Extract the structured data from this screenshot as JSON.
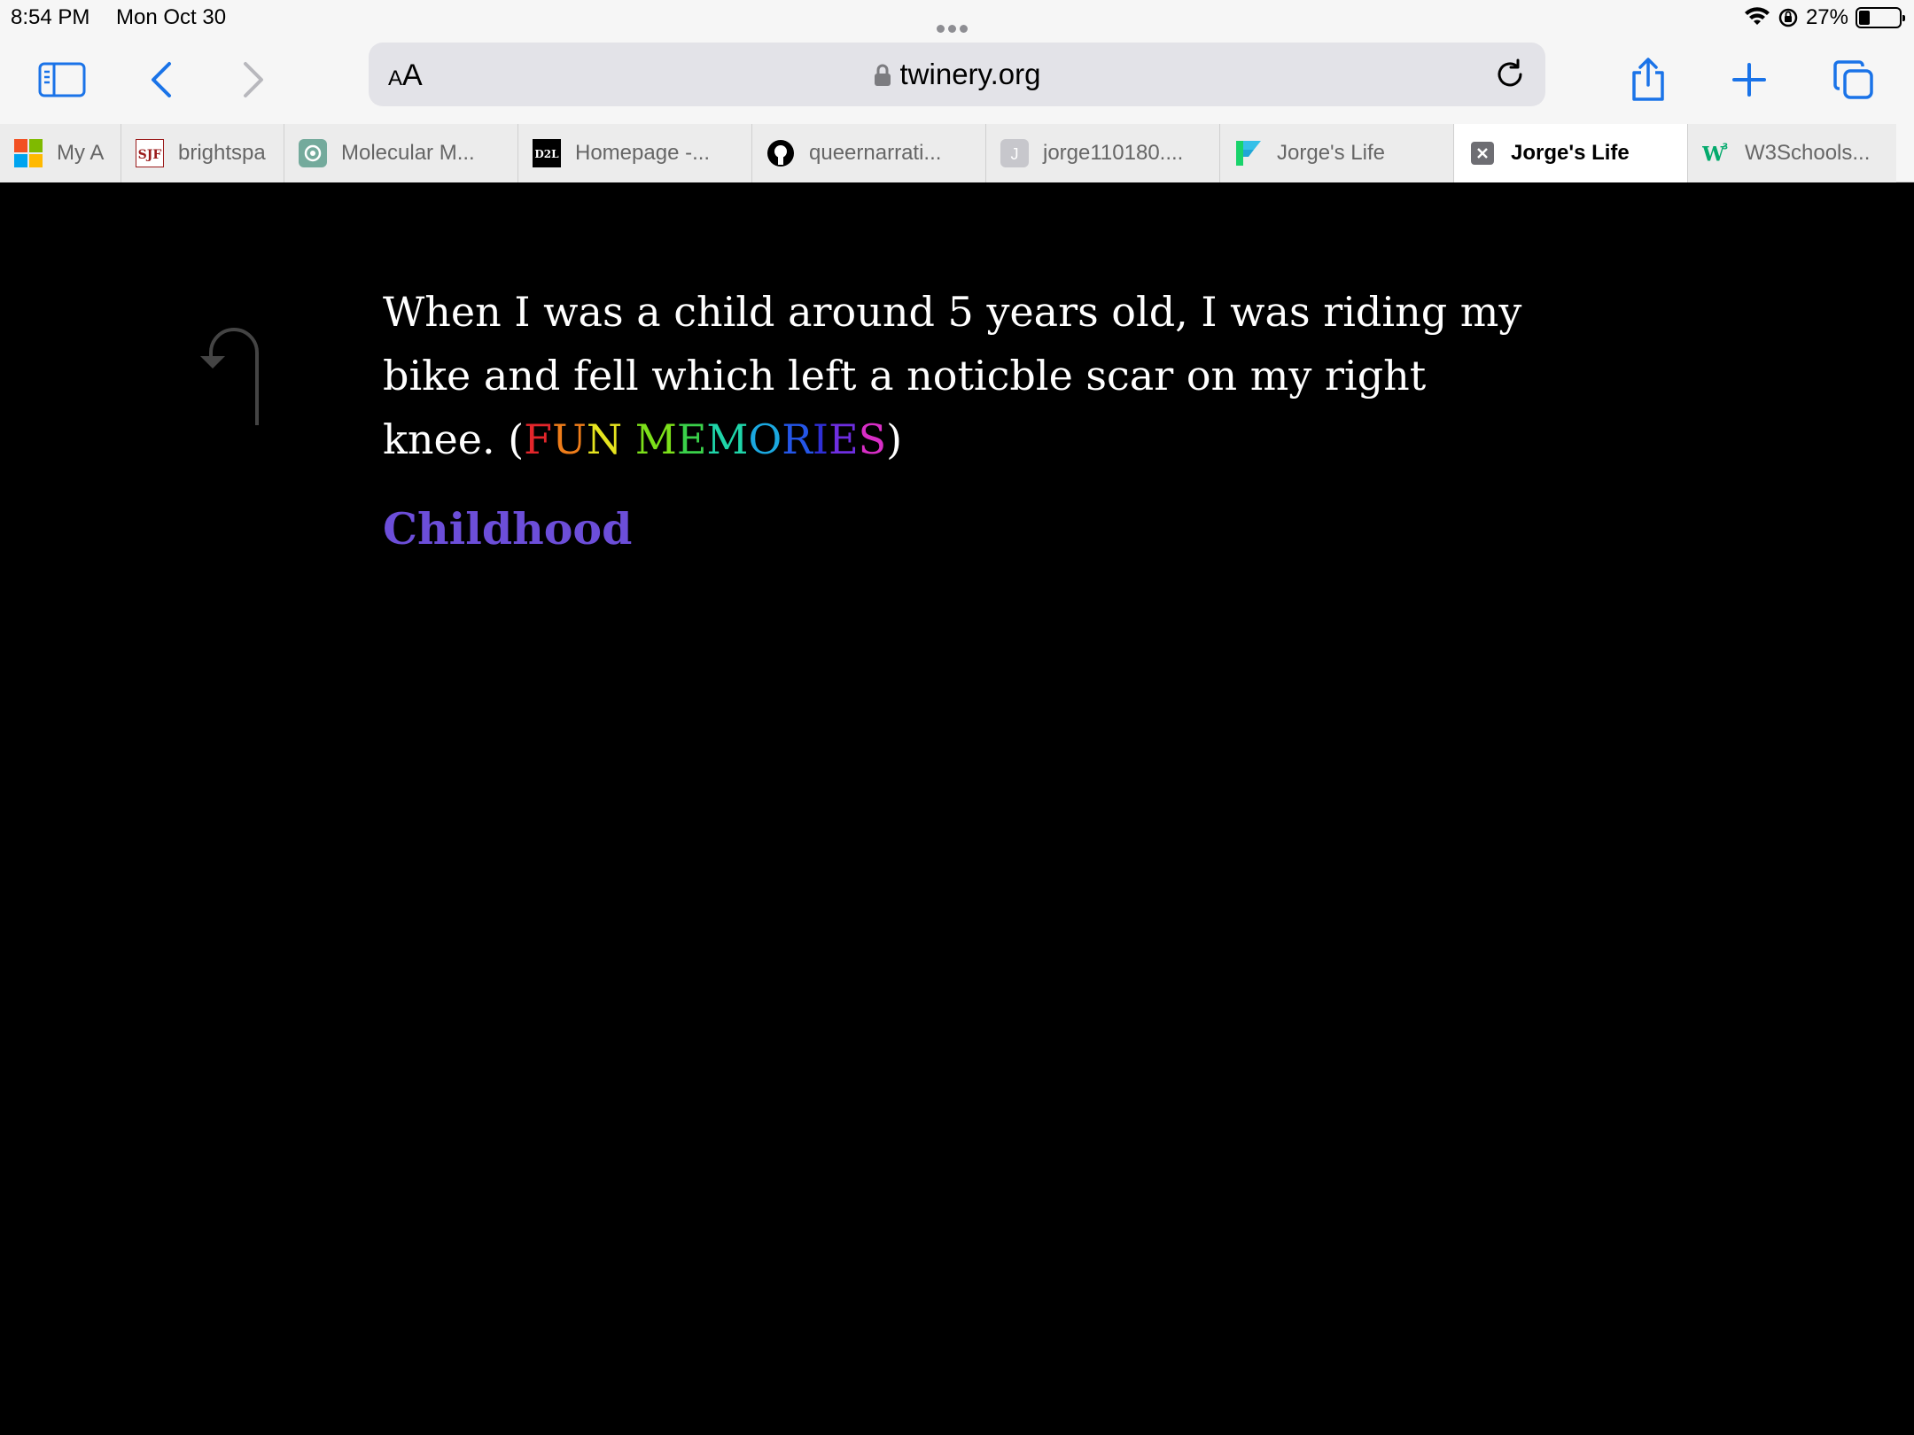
{
  "status_bar": {
    "time": "8:54 PM",
    "date": "Mon Oct 30",
    "battery": "27%",
    "battery_level": 0.27
  },
  "address_bar": {
    "text_size_label": "AA",
    "url": "twinery.org"
  },
  "toolbar_icons": [
    "sidebar-icon",
    "back-icon",
    "forward-icon",
    "share-icon",
    "new-tab-icon",
    "tabs-overview-icon"
  ],
  "tabs": [
    {
      "label": "My A",
      "favicon": "microsoft-icon"
    },
    {
      "label": "brightspa",
      "favicon": "sjf-icon"
    },
    {
      "label": "Molecular M...",
      "favicon": "openai-icon"
    },
    {
      "label": "Homepage -...",
      "favicon": "d2l-icon"
    },
    {
      "label": "queernarrati...",
      "favicon": "github-icon"
    },
    {
      "label": "jorge110180....",
      "favicon": "j-letter-icon"
    },
    {
      "label": "Jorge's Life",
      "favicon": "twine-icon"
    },
    {
      "label": "Jorge's Life",
      "favicon": "close-icon",
      "active": true
    },
    {
      "label": "W3Schools...",
      "favicon": "w3schools-icon"
    }
  ],
  "passage": {
    "text": "When I was a child around 5 years old, I was riding my bike and fell which left a noticble scar on my right knee. (",
    "rainbow_text": "FUN MEMORIES",
    "rainbow_colors": [
      "#e3262b",
      "#ef7d1a",
      "#e6e41f",
      "#ffffff",
      "#7ce01a",
      "#3ad14a",
      "#1fd5a9",
      "#1ba8e0",
      "#2456e8",
      "#2f2fd6",
      "#6e2ee0",
      "#d82ec6",
      "#f2a51e"
    ],
    "close": ")"
  },
  "link": {
    "label": "Childhood",
    "color": "#6c4ed9"
  }
}
